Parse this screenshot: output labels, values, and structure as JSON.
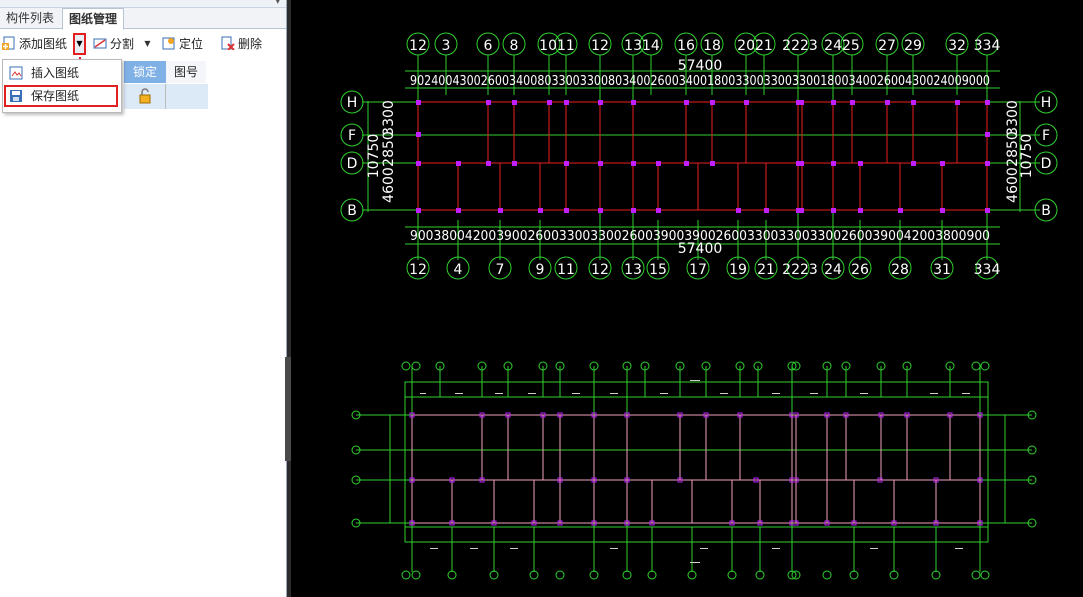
{
  "panel": {
    "tabs": [
      "构件列表",
      "图纸管理"
    ],
    "toolbar": {
      "add_label": "添加图纸",
      "split_label": "分割",
      "locate_label": "定位",
      "delete_label": "删除"
    },
    "grid_headers": [
      "锁定",
      "图号"
    ],
    "dropdown_menu": [
      "插入图纸",
      "保存图纸"
    ]
  },
  "drawing": {
    "top_axes": [
      "12",
      "3",
      "6",
      "8",
      "1011",
      "12",
      "1314",
      "16",
      "18",
      "2021",
      "2223",
      "2425",
      "27",
      "29",
      "32",
      "334"
    ],
    "bottom_axes": [
      "12",
      "4",
      "7",
      "9",
      "11",
      "12",
      "13",
      "15",
      "17",
      "19",
      "21",
      "2223",
      "24",
      "26",
      "28",
      "31",
      "334"
    ],
    "top_total": "57400",
    "top_dims": "9024004300260034008033003300803400260034001800330033003300180034002600430024009000",
    "bottom_total": "57400",
    "bottom_dims": "90038004200390026003300330026003900390026003300330033002600390042003800900",
    "row_labels": [
      "H",
      "F",
      "D",
      "B"
    ],
    "left_dims": [
      "10750",
      "4600",
      "2850",
      "3300"
    ],
    "right_dims": [
      "4600",
      "2850",
      "3300",
      "10750"
    ]
  },
  "colors": {
    "grid_green": "#2fd12f",
    "beam_red": "#e82020",
    "column_magenta": "#c020ff",
    "highlight_red": "#e02020"
  }
}
